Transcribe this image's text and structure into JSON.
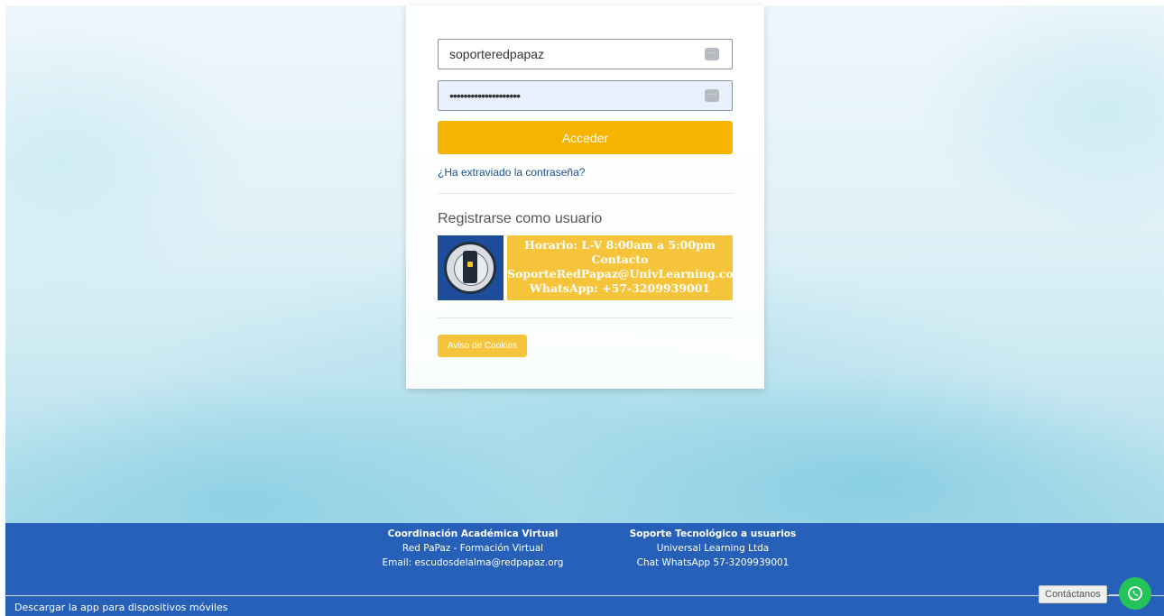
{
  "login": {
    "username_value": "soporteredpapaz",
    "password_mask": "••••••••••••••••••••",
    "login_button": "Acceder",
    "forgot_link": "¿Ha extraviado la contraseña?",
    "register_title": "Registrarse como usuario",
    "cookies_button": "Aviso de Cookies"
  },
  "promo": {
    "line1": "Horario: L-V 8:00am a  5:00pm",
    "line2": "Contacto",
    "line3": "SoporteRedPapaz@UnivLearning.com",
    "line4": "WhatsApp: +57-3209939001"
  },
  "footer": {
    "left": {
      "heading": "Coordinación Académica Virtual",
      "line1": "Red PaPaz - Formación Virtual",
      "line2": "Email: escudosdelalma@redpapaz.org"
    },
    "right": {
      "heading": "Soporte Tecnológico a usuarios",
      "line1": "Universal Learning Ltda",
      "line2": "Chat WhatsApp 57-3209939001"
    },
    "app_link": "Descargar la app para dispositivos móviles"
  },
  "contact_widget": {
    "label": "Contáctanos",
    "icon": "whatsapp-icon"
  },
  "colors": {
    "accent": "#f6b400",
    "footer": "#2760b8",
    "whatsapp": "#25c45b"
  }
}
